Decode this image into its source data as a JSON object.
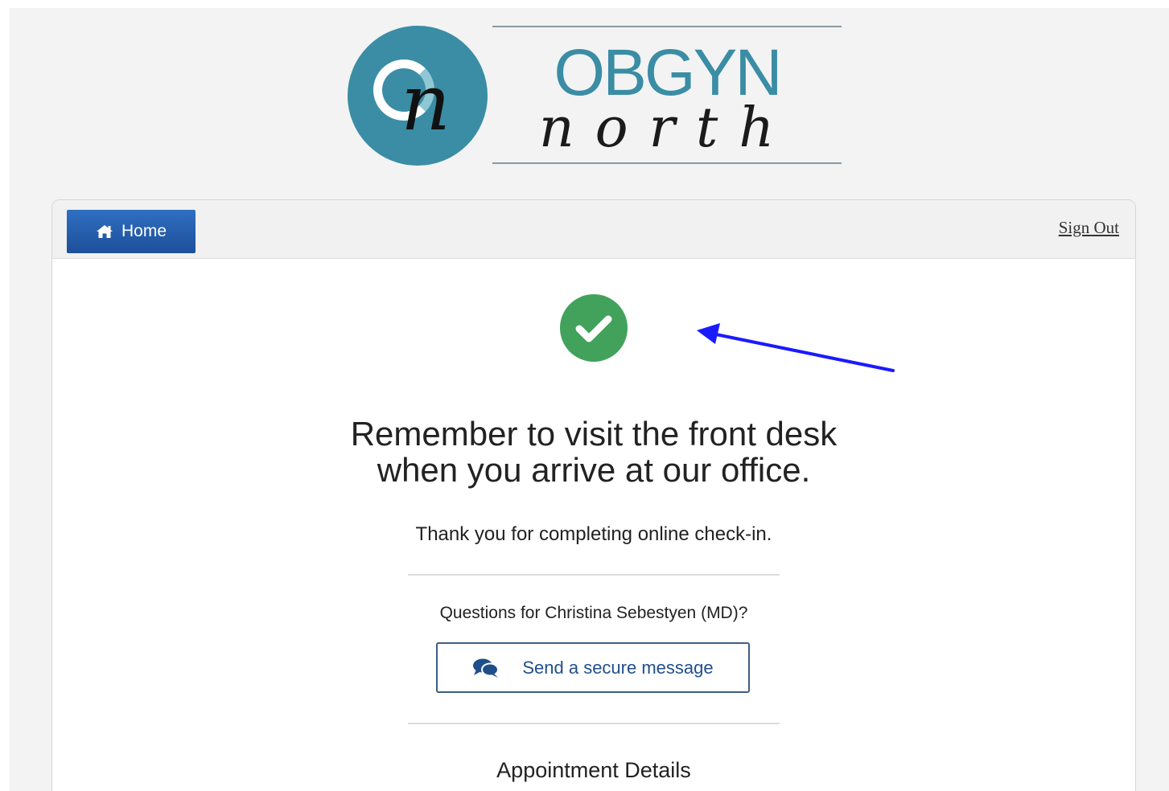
{
  "logo": {
    "monogram": "n",
    "brand": "OBGYN",
    "subbrand": "north",
    "brand_color": "#3a8da4"
  },
  "navbar": {
    "home_label": "Home",
    "home_icon": "home-icon",
    "signout_label": "Sign Out"
  },
  "confirmation": {
    "icon": "check-circle-icon",
    "icon_color": "#42a25b",
    "headline_line1": "Remember to visit the front desk",
    "headline_line2": "when you arrive at our office.",
    "thanks": "Thank you for completing online check-in."
  },
  "contact": {
    "question": "Questions for Christina Sebestyen (MD)?",
    "button_label": "Send a secure message",
    "button_icon": "chat-bubbles-icon"
  },
  "appointment": {
    "heading": "Appointment Details"
  },
  "annotation": {
    "icon": "arrow-annotation",
    "color": "#1a1aff"
  }
}
